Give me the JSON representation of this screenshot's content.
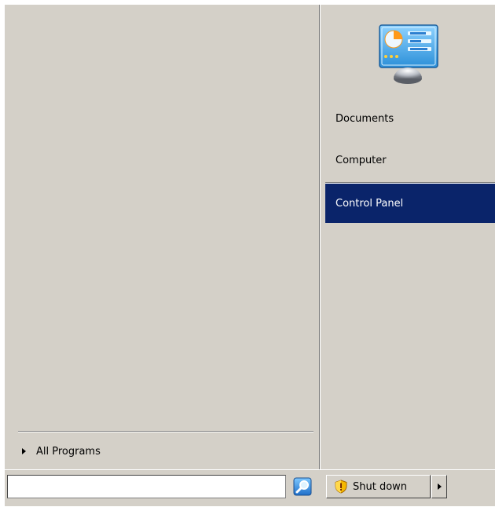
{
  "left_pane": {
    "all_programs_label": "All Programs"
  },
  "right_pane": {
    "icon": "control-panel-icon",
    "items": [
      {
        "label": "Documents",
        "selected": false
      },
      {
        "label": "Computer",
        "selected": false
      },
      {
        "label": "Control Panel",
        "selected": true
      }
    ]
  },
  "bottom_bar": {
    "search": {
      "value": "",
      "placeholder": "",
      "icon": "search-icon"
    },
    "shutdown": {
      "label": "Shut down",
      "icon": "shield-icon"
    },
    "shutdown_options_icon": "arrow-right-icon"
  },
  "colors": {
    "menu_background": "#d4d0c8",
    "selection_background": "#0a246a",
    "selection_text": "#ffffff"
  }
}
